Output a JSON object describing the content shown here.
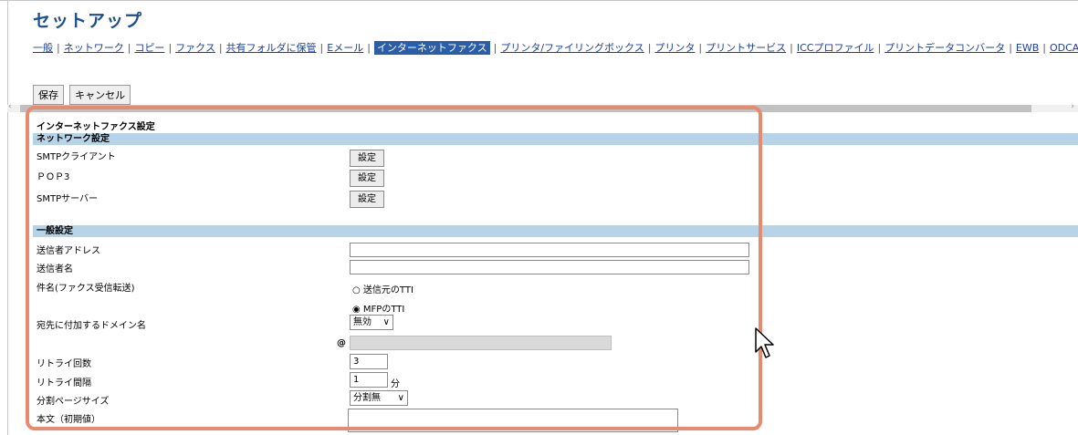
{
  "page_title": "セットアップ",
  "nav": [
    {
      "label": "一般",
      "active": false
    },
    {
      "label": "ネットワーク",
      "active": false
    },
    {
      "label": "コピー",
      "active": false
    },
    {
      "label": "ファクス",
      "active": false
    },
    {
      "label": "共有フォルダに保管",
      "active": false
    },
    {
      "label": "Eメール",
      "active": false
    },
    {
      "label": "インターネットファクス",
      "active": true
    },
    {
      "label": "プリンタ/ファイリングボックス",
      "active": false
    },
    {
      "label": "プリンタ",
      "active": false
    },
    {
      "label": "プリントサービス",
      "active": false
    },
    {
      "label": "ICCプロファイル",
      "active": false
    },
    {
      "label": "プリントデータコンバータ",
      "active": false
    },
    {
      "label": "EWB",
      "active": false
    },
    {
      "label": "ODCA",
      "active": false
    }
  ],
  "toolbar": {
    "save_label": "保存",
    "cancel_label": "キャンセル"
  },
  "settings": {
    "header": "インターネットファクス設定",
    "network": {
      "title": "ネットワーク設定",
      "smtp_client": "SMTPクライアント",
      "pop3": "ＰＯＰ3",
      "smtp_server": "SMTPサーバー",
      "button_label": "設定"
    },
    "general": {
      "title": "一般設定",
      "sender_address_label": "送信者アドレス",
      "sender_address_value": "",
      "sender_name_label": "送信者名",
      "sender_name_value": "",
      "subject_label": "件名(ファクス受信転送)",
      "subject_options": [
        {
          "label": "送信元のTTI",
          "selected": false
        },
        {
          "label": "MFPのTTI",
          "selected": true
        }
      ],
      "domain_label": "宛先に付加するドメイン名",
      "domain_select": "無効",
      "at_symbol": "@",
      "domain_value": "",
      "retry_count_label": "リトライ回数",
      "retry_count_value": "3",
      "retry_interval_label": "リトライ間隔",
      "retry_interval_value": "1",
      "retry_interval_unit": "分",
      "split_page_label": "分割ページサイズ",
      "split_page_select": "分割無",
      "body_label": "本文（初期値）",
      "body_value": ""
    }
  },
  "colors": {
    "highlight": "#e88a6e",
    "section_bg": "#b6d3e8",
    "nav_active": "#2b5ea8"
  }
}
